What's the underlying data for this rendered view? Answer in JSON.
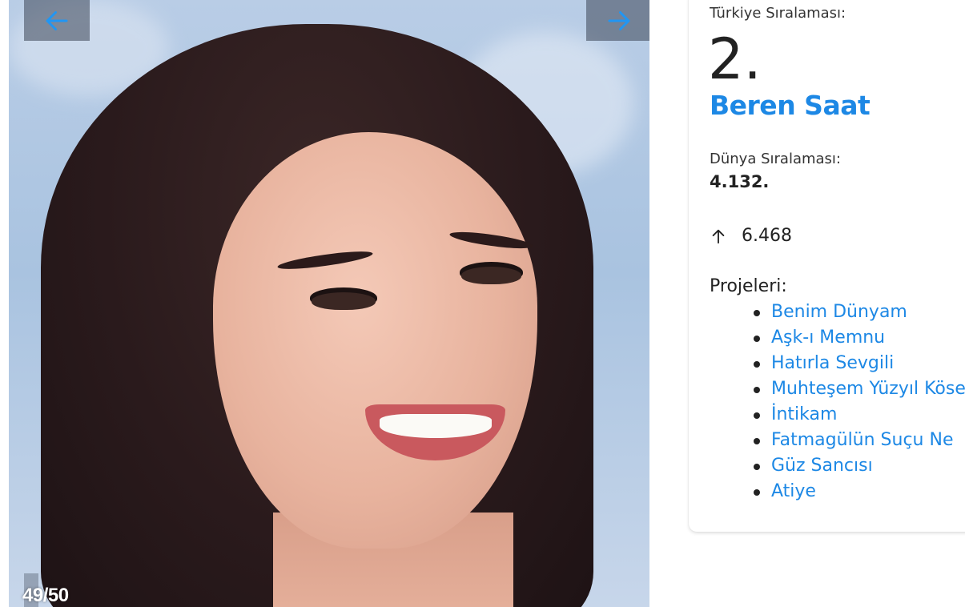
{
  "gallery": {
    "counter": "49/50",
    "prev_icon": "arrow-left-icon",
    "next_icon": "arrow-right-icon",
    "photo_subject": "portrait photo"
  },
  "profile": {
    "turkey_rank_label": "Türkiye Sıralaması:",
    "turkey_rank": "2.",
    "name": "Beren Saat",
    "world_rank_label": "Dünya Sıralaması:",
    "world_rank": "4.132.",
    "change_icon": "arrow-up-icon",
    "change_value": "6.468",
    "projects_label": "Projeleri:",
    "projects": [
      "Benim Dünyam",
      "Aşk-ı Memnu",
      "Hatırla Sevgili",
      "Muhteşem Yüzyıl Kösem",
      "İntikam",
      "Fatmagülün Suçu Ne",
      "Güz Sancısı",
      "Atiye"
    ]
  },
  "colors": {
    "accent": "#1d88e5",
    "nav_overlay": "#3c4655"
  }
}
